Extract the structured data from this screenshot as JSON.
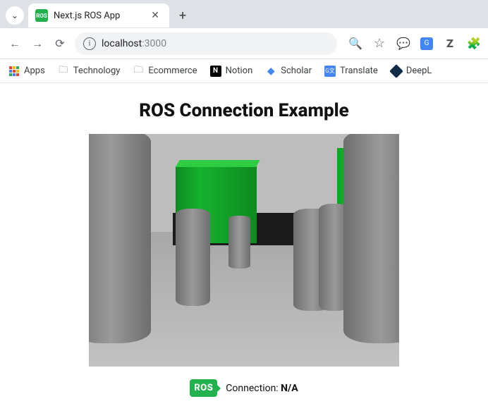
{
  "browser": {
    "tab": {
      "title": "Next.js ROS App",
      "favicon_text": "ROS"
    },
    "address": {
      "host": "localhost",
      "port": ":3000"
    },
    "bookmarks": {
      "apps": "Apps",
      "technology": "Technology",
      "ecommerce": "Ecommerce",
      "notion": "Notion",
      "scholar": "Scholar",
      "translate": "Translate",
      "deepl": "DeepL"
    }
  },
  "page": {
    "heading": "ROS Connection Example",
    "status_label": "Connection: ",
    "status_value": "N/A",
    "ros_logo_text": "ROS"
  }
}
